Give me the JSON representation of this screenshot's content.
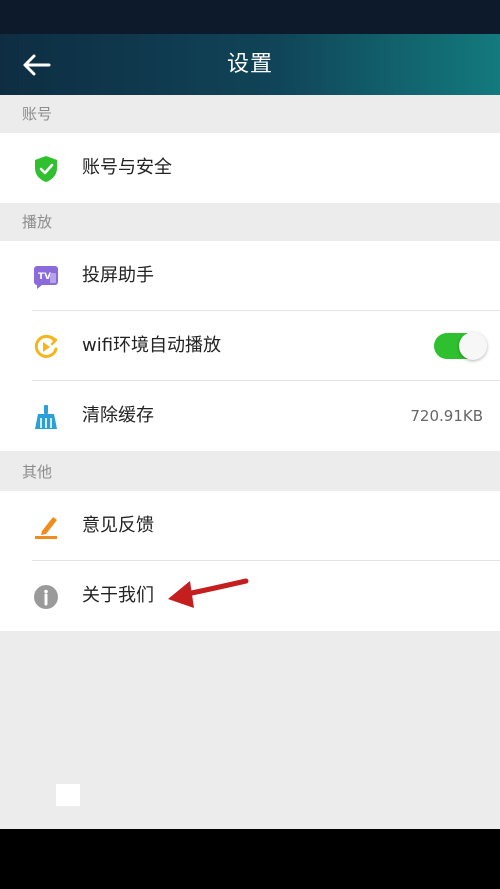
{
  "header": {
    "title": "设置",
    "back_icon": "arrow-left-icon"
  },
  "sections": [
    {
      "title": "账号",
      "items": [
        {
          "label": "账号与安全",
          "icon": "shield-check-icon",
          "icon_color": "#2ec02e"
        }
      ]
    },
    {
      "title": "播放",
      "items": [
        {
          "label": "投屏助手",
          "icon": "tv-icon",
          "icon_color": "#8b6bd9"
        },
        {
          "label": "wifi环境自动播放",
          "icon": "auto-play-icon",
          "icon_color": "#f5b51e",
          "toggle_on": true
        },
        {
          "label": "清除缓存",
          "icon": "broom-icon",
          "icon_color": "#2a9fd8",
          "value": "720.91KB"
        }
      ]
    },
    {
      "title": "其他",
      "items": [
        {
          "label": "意见反馈",
          "icon": "feedback-pen-icon",
          "icon_color": "#f08c1e"
        },
        {
          "label": "关于我们",
          "icon": "info-icon",
          "icon_color": "#9a9a9a"
        }
      ]
    }
  ],
  "colors": {
    "app_bar_start": "#0e2d42",
    "app_bar_end": "#137a7e",
    "toggle_on": "#2ec02e",
    "annotation_arrow": "#c41e1e"
  }
}
